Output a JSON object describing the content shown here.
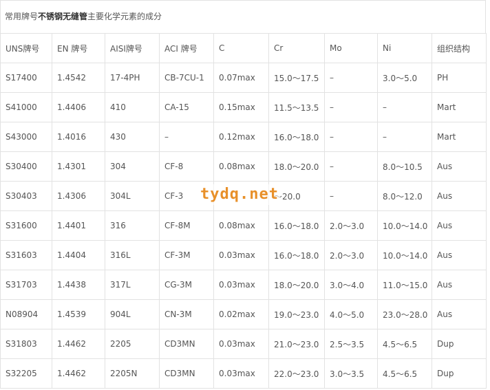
{
  "caption": {
    "prefix": "常用牌号",
    "emphasis": "不锈钢无缝管",
    "suffix": "主要化学元素的成分"
  },
  "table": {
    "headers": [
      "UNS牌号",
      "EN 牌号",
      "AISI牌号",
      "ACI 牌号",
      "C",
      "Cr",
      "Mo",
      "Ni",
      "组织结构"
    ],
    "rows": [
      [
        "S17400",
        "1.4542",
        "17-4PH",
        "CB-7CU-1",
        "0.07max",
        "15.0～17.5",
        "–",
        "3.0～5.0",
        "PH"
      ],
      [
        "S41000",
        "1.4406",
        "410",
        "CA-15",
        "0.15max",
        "11.5～13.5",
        "–",
        "–",
        "Mart"
      ],
      [
        "S43000",
        "1.4016",
        "430",
        "–",
        "0.12max",
        "16.0～18.0",
        "–",
        "–",
        "Mart"
      ],
      [
        "S30400",
        "1.4301",
        "304",
        "CF-8",
        "0.08max",
        "18.0～20.0",
        "–",
        "8.0～10.5",
        "Aus"
      ],
      [
        "S30403",
        "1.4306",
        "304L",
        "CF-3",
        "",
        "～20.0",
        "–",
        "8.0～12.0",
        "Aus"
      ],
      [
        "S31600",
        "1.4401",
        "316",
        "CF-8M",
        "0.08max",
        "16.0～18.0",
        "2.0～3.0",
        "10.0～14.0",
        "Aus"
      ],
      [
        "S31603",
        "1.4404",
        "316L",
        "CF-3M",
        "0.03max",
        "16.0～18.0",
        "2.0～3.0",
        "10.0～14.0",
        "Aus"
      ],
      [
        "S31703",
        "1.4438",
        "317L",
        "CG-3M",
        "0.03max",
        "18.0～20.0",
        "3.0～4.0",
        "11.0～15.0",
        "Aus"
      ],
      [
        "N08904",
        "1.4539",
        "904L",
        "CN-3M",
        "0.02max",
        "19.0～23.0",
        "4.0～5.0",
        "23.0～28.0",
        "Aus"
      ],
      [
        "S31803",
        "1.4462",
        "2205",
        "CD3MN",
        "0.03max",
        "21.0～23.0",
        "2.5～3.5",
        "4.5～6.5",
        "Dup"
      ],
      [
        "S32205",
        "1.4462",
        "2205N",
        "CD3MN",
        "0.03max",
        "22.0～23.0",
        "3.0～3.5",
        "4.5～6.5",
        "Dup"
      ]
    ]
  },
  "watermark": "tydq.net"
}
